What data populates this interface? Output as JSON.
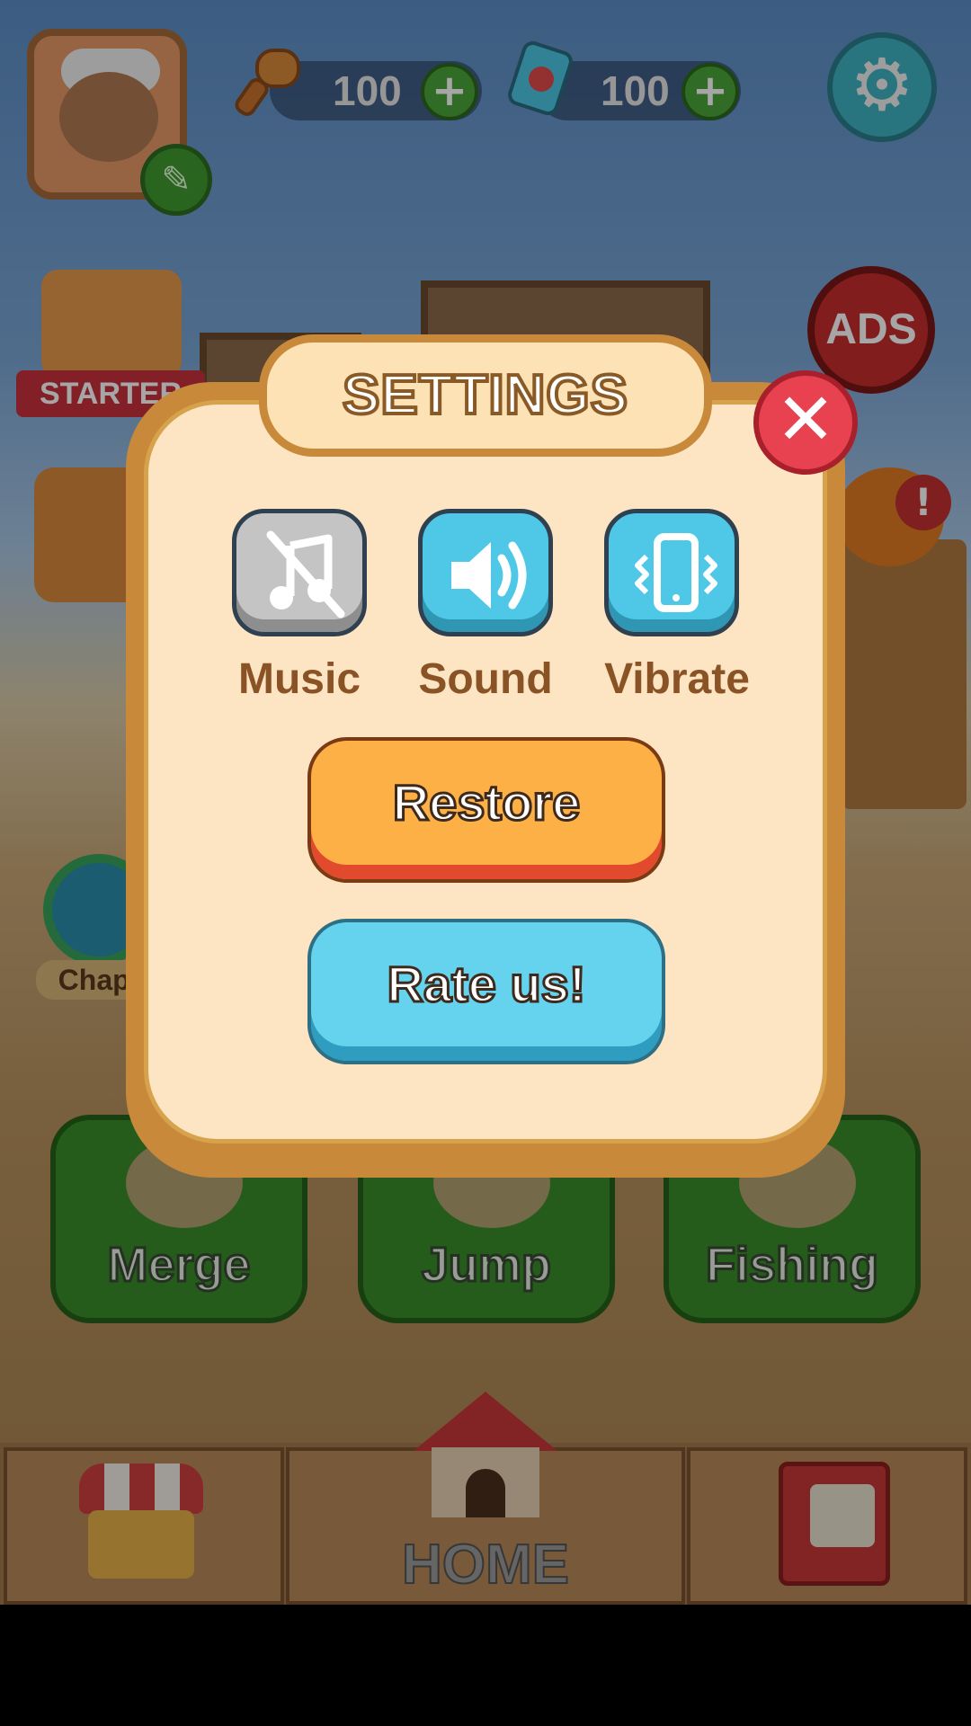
{
  "hud": {
    "hammer_count": "100",
    "ticket_count": "100"
  },
  "side": {
    "starter_label": "STARTER",
    "ads_label": "ADS",
    "chapter_label": "Chapt",
    "alert_mark": "!"
  },
  "minigames": [
    {
      "label": "Merge"
    },
    {
      "label": "Jump"
    },
    {
      "label": "Fishing"
    }
  ],
  "nav": {
    "home_label": "HOME"
  },
  "dialog": {
    "title": "SETTINGS",
    "close_glyph": "✕",
    "toggles": [
      {
        "label": "Music",
        "icon": "music-off-icon",
        "state": "off"
      },
      {
        "label": "Sound",
        "icon": "speaker-icon",
        "state": "on"
      },
      {
        "label": "Vibrate",
        "icon": "vibrate-phone-icon",
        "state": "on"
      }
    ],
    "restore_label": "Restore",
    "rate_label": "Rate us!"
  },
  "colors": {
    "dialog_fill": "#fde4c2",
    "dialog_border": "#c8893a",
    "restore": "#fcb045",
    "rate": "#65d3ee",
    "close": "#e8414f",
    "label_brown": "#8a5326"
  }
}
